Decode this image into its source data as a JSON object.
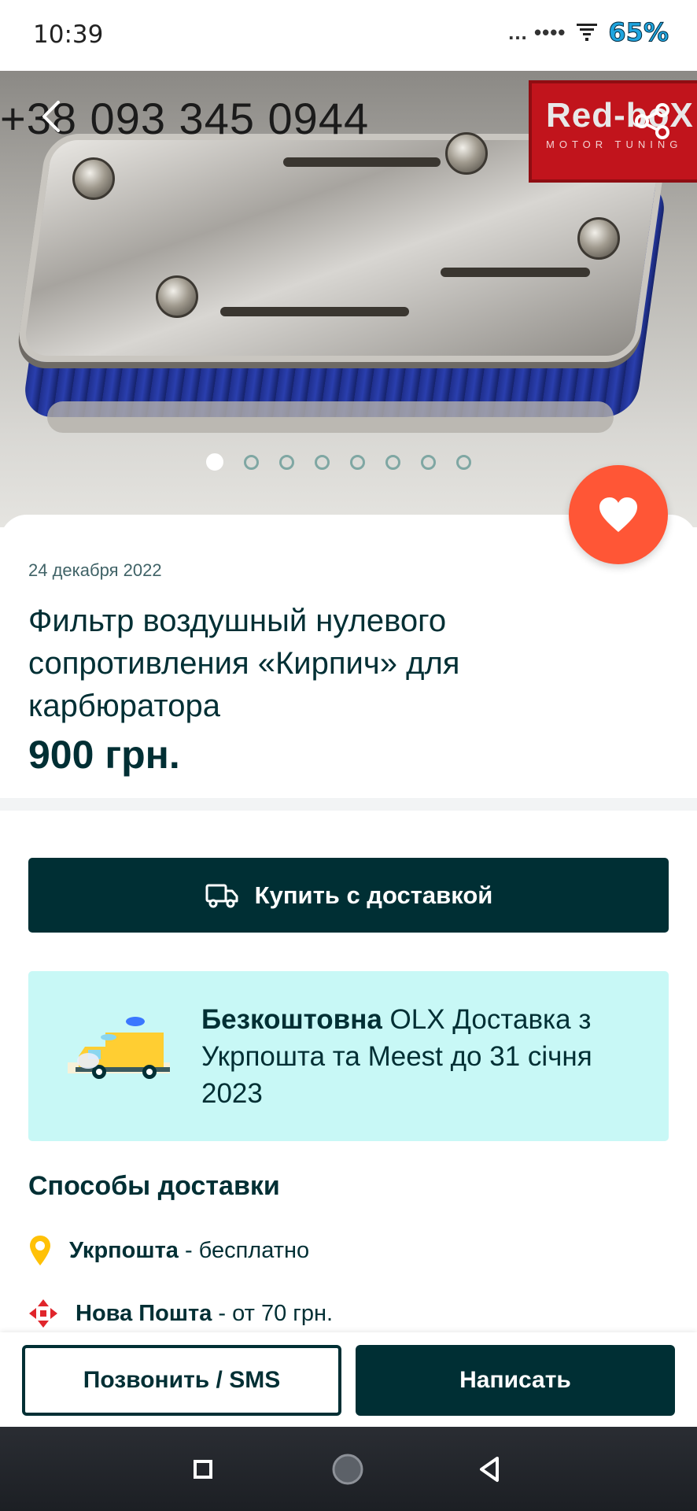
{
  "status_bar": {
    "time": "10:39",
    "dots": "... ••••",
    "battery": "65%"
  },
  "hero": {
    "phone_overlay": "+38 093 345 0944",
    "brand_name": "Red-boX",
    "brand_sub": "MOTOR TUNING",
    "image_count": 8,
    "active_index": 0
  },
  "listing": {
    "date": "24 декабря 2022",
    "title": "Фильтр воздушный нулевого сопротивления «Кирпич» для карбюратора",
    "price": "900 грн."
  },
  "buy": {
    "label": "Купить с доставкой"
  },
  "promo": {
    "bold": "Безкоштовна",
    "text": " OLX Доставка з Укрпошта та Meest до 31 січня 2023"
  },
  "delivery": {
    "title": "Способы доставки",
    "methods": [
      {
        "name": "Укрпошта",
        "detail": " - бесплатно",
        "icon": "ukrposhta-pin-icon"
      },
      {
        "name": "Нова Пошта",
        "detail": " - от 70 грн.",
        "icon": "nova-poshta-icon"
      }
    ]
  },
  "actions": {
    "call_label": "Позвонить / SMS",
    "write_label": "Написать"
  },
  "colors": {
    "primary": "#002f34",
    "favorite": "#ff5636",
    "promo_bg": "#c8f8f6"
  }
}
